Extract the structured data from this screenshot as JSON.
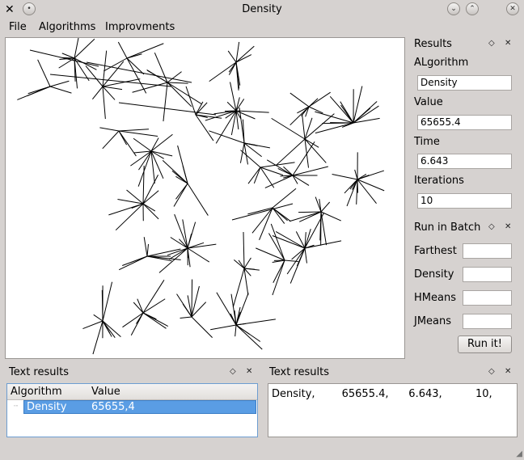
{
  "window": {
    "title": "Density",
    "app_icon": "x-logo-icon"
  },
  "menu": {
    "file": "File",
    "algorithms": "Algorithms",
    "improvements": "Improvments"
  },
  "results_dock": {
    "title": "Results",
    "algorithm_label": "ALgorithm",
    "algorithm_value": "Density",
    "value_label": "Value",
    "value_value": "65655.4",
    "time_label": "Time",
    "time_value": "6.643",
    "iterations_label": "Iterations",
    "iterations_value": "10"
  },
  "batch_dock": {
    "title": "Run in Batch",
    "farthest_label": "Farthest",
    "density_label": "Density",
    "hmeans_label": "HMeans",
    "jmeans_label": "JMeans",
    "run_button": "Run it!"
  },
  "text_results_left": {
    "title": "Text results",
    "columns": [
      "Algorithm",
      "Value"
    ],
    "rows": [
      {
        "algorithm": "Density",
        "value": "65655,4"
      }
    ]
  },
  "text_results_right": {
    "title": "Text results",
    "content": "Density,        65655.4,      6.643,          10,"
  },
  "colors": {
    "selection": "#5a9de4",
    "background": "#d6d2d0"
  }
}
